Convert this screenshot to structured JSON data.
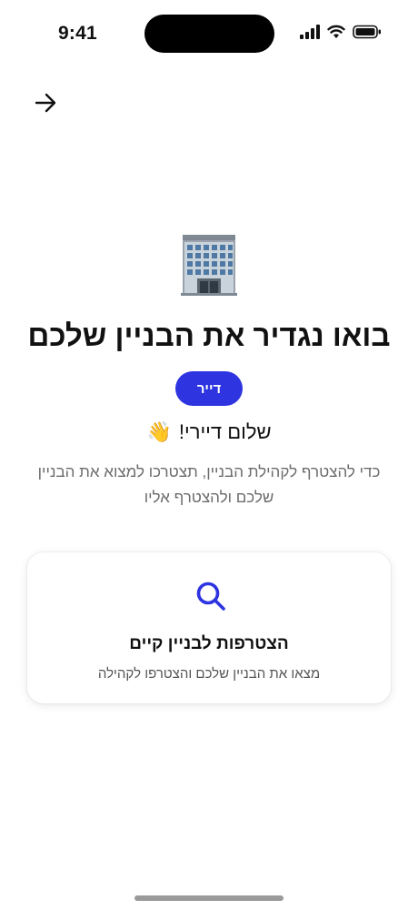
{
  "status_bar": {
    "time": "9:41"
  },
  "header": {
    "back_icon": "arrow-right-icon"
  },
  "hero": {
    "icon": "office-building-emoji"
  },
  "title": "בואו נגדיר את הבניין שלכם",
  "role_pill": "דייר",
  "greeting": {
    "text": "שלום דיירי!",
    "emoji": "👋"
  },
  "description": "כדי להצטרף לקהילת הבניין, תצטרכו למצוא את הבניין שלכם ולהצטרף אליו",
  "join_card": {
    "icon": "search-icon",
    "title": "הצטרפות לבניין קיים",
    "subtitle": "מצאו את הבניין שלכם והצטרפו לקהילה"
  },
  "colors": {
    "accent": "#2d34e0",
    "muted_text": "#6b6b6b"
  }
}
